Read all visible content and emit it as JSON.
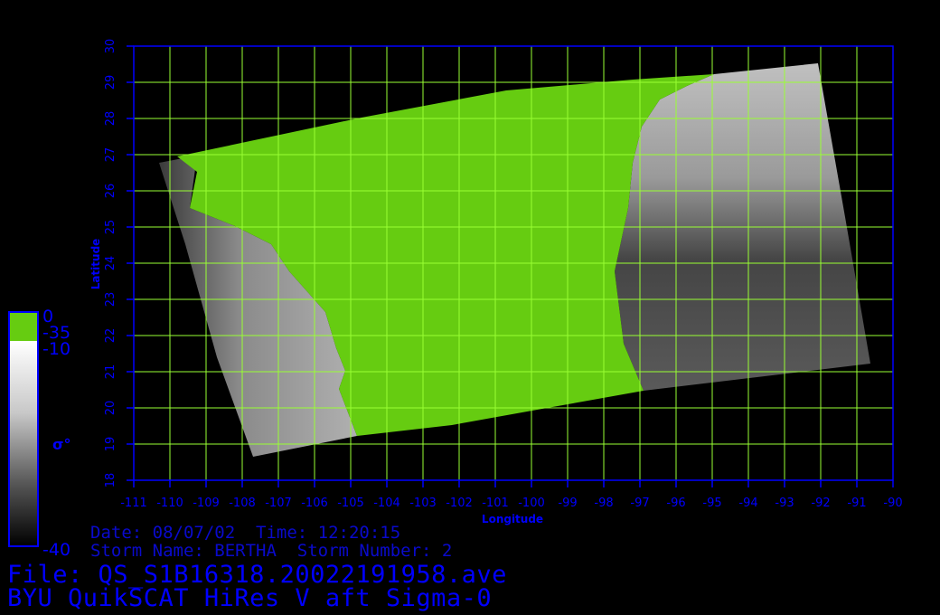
{
  "map": {
    "latitude_label": "Latitude",
    "longitude_label": "Longitude",
    "lat_ticks": [
      "18",
      "19",
      "20",
      "21",
      "22",
      "23",
      "24",
      "25",
      "26",
      "27",
      "28",
      "29",
      "30"
    ],
    "lon_ticks": [
      "-111",
      "-110",
      "-109",
      "-108",
      "-107",
      "-106",
      "-105",
      "-104",
      "-103",
      "-102",
      "-101",
      "-100",
      "-99",
      "-98",
      "-97",
      "-96",
      "-95",
      "-94",
      "-93",
      "-92",
      "-91",
      "-90"
    ],
    "lat_range": [
      18,
      30
    ],
    "lon_range": [
      -111,
      -90
    ],
    "grid": true,
    "colors": {
      "axis": "#0000ff",
      "grid": "#99ff33",
      "land_mask": "#66cc11",
      "ocean_high": "#ffffff",
      "ocean_low": "#000000"
    }
  },
  "colorbar": {
    "top_label": "0",
    "mask_label": "-35",
    "upper_label": "-10",
    "bottom_label": "-40",
    "quantity_label": "σ°"
  },
  "info": {
    "date_line": "Date: 08/07/02  Time: 12:20:15",
    "storm_line": "Storm Name: BERTHA  Storm Number: 2",
    "file_line": "File: QS_S1B16318.20022191958.ave",
    "title_line": "BYU QuikSCAT HiRes V aft Sigma-0"
  }
}
